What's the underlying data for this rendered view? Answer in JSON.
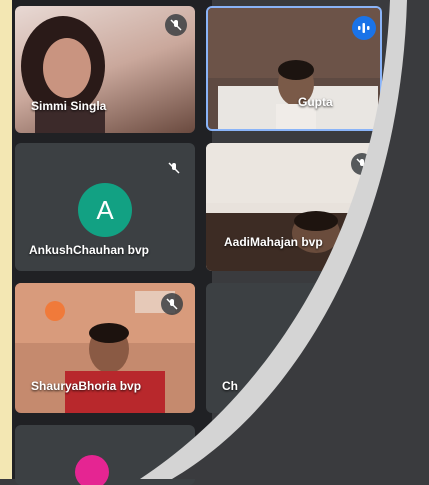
{
  "participants": [
    {
      "name": "Simmi Singla",
      "mic": "muted"
    },
    {
      "name": "Gupta",
      "mic": "speaking"
    },
    {
      "name": "AnkushChauhan bvp",
      "mic": "muted",
      "avatar_letter": "A",
      "avatar_color": "#12a183"
    },
    {
      "name": "AadiMahajan bvp",
      "mic": "muted"
    },
    {
      "name": "ShauryaBhoria bvp",
      "mic": "muted"
    },
    {
      "name": "Ch",
      "mic": "none"
    }
  ],
  "colors": {
    "background": "#3a3b3e",
    "tile": "#3c4043",
    "active_speaker": "#1a73e8",
    "curve": "#d4d4d4",
    "left_strip": "#f3e7b3"
  },
  "icons": {
    "muted": "mic-off-icon",
    "speaking": "audio-wave-icon"
  }
}
